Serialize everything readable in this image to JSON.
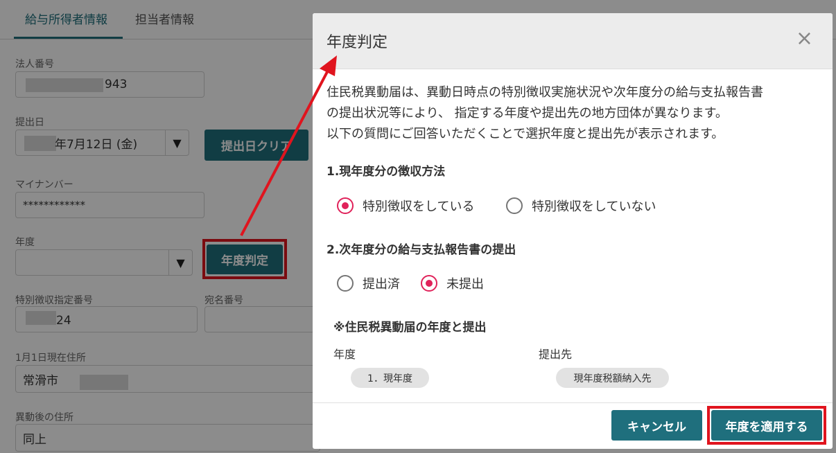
{
  "tabs": [
    "給与所得者情報",
    "担当者情報"
  ],
  "form": {
    "corp_number": {
      "label": "法人番号",
      "value": "943"
    },
    "submit_date": {
      "label": "提出日",
      "value": "年7月12日 (金)",
      "clear_button": "提出日クリア"
    },
    "my_number": {
      "label": "マイナンバー",
      "value": "************"
    },
    "fiscal_year": {
      "label": "年度",
      "value": "",
      "judge_button": "年度判定"
    },
    "special_number": {
      "label": "特別徴収指定番号",
      "value": "24"
    },
    "address_number": {
      "label": "宛名番号",
      "value": ""
    },
    "jan1_address": {
      "label": "1月1日現在住所",
      "value": "常滑市"
    },
    "new_address": {
      "label": "異動後の住所",
      "value": "同上"
    }
  },
  "modal": {
    "title": "年度判定",
    "close_icon": "×",
    "description": [
      "住民税異動届は、異動日時点の特別徴収実施状況や次年度分の給与支払報告書",
      "の提出状況等により、 指定する年度や提出先の地方団体が異なります。",
      "以下の質問にご回答いただくことで選択年度と提出先が表示されます。"
    ],
    "q1": {
      "title": "1.現年度分の徴収方法",
      "options": [
        {
          "label": "特別徴収をしている",
          "selected": true
        },
        {
          "label": "特別徴収をしていない",
          "selected": false
        }
      ]
    },
    "q2": {
      "title": "2.次年度分の給与支払報告書の提出",
      "options": [
        {
          "label": "提出済",
          "selected": false
        },
        {
          "label": "未提出",
          "selected": true
        }
      ]
    },
    "result": {
      "title": "※住民税異動届の年度と提出",
      "year_label": "年度",
      "dest_label": "提出先",
      "year_value": "1．現年度",
      "dest_value": "現年度税額納入先"
    },
    "cancel_button": "キャンセル",
    "apply_button": "年度を適用する"
  },
  "colors": {
    "accent": "#1f6f7d",
    "radio": "#e0225a",
    "highlight": "#e0141e"
  }
}
